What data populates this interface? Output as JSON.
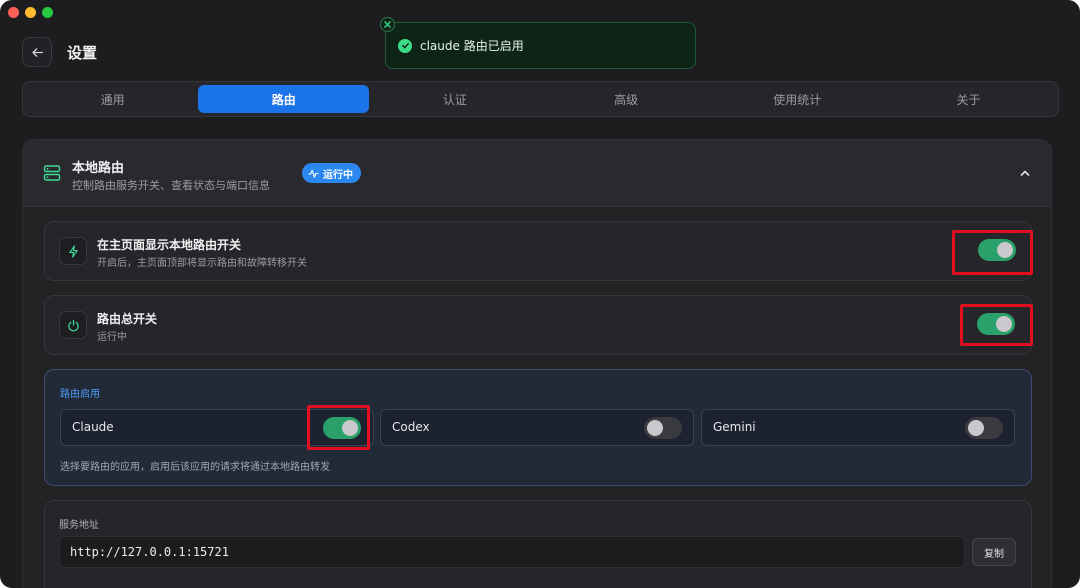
{
  "header": {
    "title": "设置"
  },
  "toast": {
    "message": "claude 路由已启用"
  },
  "tabs": [
    {
      "label": "通用",
      "active": false
    },
    {
      "label": "路由",
      "active": true
    },
    {
      "label": "认证",
      "active": false
    },
    {
      "label": "高级",
      "active": false
    },
    {
      "label": "使用统计",
      "active": false
    },
    {
      "label": "关于",
      "active": false
    }
  ],
  "local_router": {
    "title": "本地路由",
    "subtitle": "控制路由服务开关、查看状态与端口信息",
    "status_badge": "运行中"
  },
  "settings": {
    "show_switch": {
      "title": "在主页面显示本地路由开关",
      "description": "开启后，主页面顶部将显示路由和故障转移开关",
      "enabled": true
    },
    "master_switch": {
      "title": "路由总开关",
      "description": "运行中",
      "enabled": true
    }
  },
  "apps": {
    "label": "路由启用",
    "items": [
      {
        "name": "Claude",
        "enabled": true
      },
      {
        "name": "Codex",
        "enabled": false
      },
      {
        "name": "Gemini",
        "enabled": false
      }
    ],
    "hint": "选择要路由的应用，启用后该应用的请求将通过本地路由转发"
  },
  "service": {
    "label": "服务地址",
    "address": "http://127.0.0.1:15721",
    "copy_label": "复制"
  },
  "colors": {
    "accent": "#1a73e8",
    "toggle_on": "#2aa06a",
    "toast_bg": "#0e2417",
    "highlight": "#e0101f"
  }
}
